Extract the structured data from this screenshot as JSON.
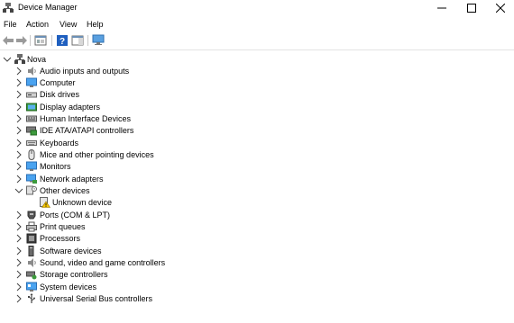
{
  "window": {
    "title": "Device Manager"
  },
  "menu": [
    "File",
    "Action",
    "View",
    "Help"
  ],
  "tree": {
    "root": "Nova",
    "categories": [
      {
        "label": "Audio inputs and outputs",
        "icon": "speaker-icon"
      },
      {
        "label": "Computer",
        "icon": "monitor-icon"
      },
      {
        "label": "Disk drives",
        "icon": "disk-drive-icon"
      },
      {
        "label": "Display adapters",
        "icon": "display-adapter-icon"
      },
      {
        "label": "Human Interface Devices",
        "icon": "hid-icon"
      },
      {
        "label": "IDE ATA/ATAPI controllers",
        "icon": "ide-controller-icon"
      },
      {
        "label": "Keyboards",
        "icon": "keyboard-icon"
      },
      {
        "label": "Mice and other pointing devices",
        "icon": "mouse-icon"
      },
      {
        "label": "Monitors",
        "icon": "monitor-icon"
      },
      {
        "label": "Network adapters",
        "icon": "network-adapter-icon"
      },
      {
        "label": "Other devices",
        "icon": "other-devices-icon",
        "expanded": true,
        "children": [
          {
            "label": "Unknown device",
            "icon": "unknown-device-warning-icon"
          }
        ]
      },
      {
        "label": "Ports (COM & LPT)",
        "icon": "port-icon"
      },
      {
        "label": "Print queues",
        "icon": "printer-icon"
      },
      {
        "label": "Processors",
        "icon": "processor-icon"
      },
      {
        "label": "Software devices",
        "icon": "software-device-icon"
      },
      {
        "label": "Sound, video and game controllers",
        "icon": "speaker-icon"
      },
      {
        "label": "Storage controllers",
        "icon": "storage-controller-icon"
      },
      {
        "label": "System devices",
        "icon": "system-devices-icon"
      },
      {
        "label": "Universal Serial Bus controllers",
        "icon": "usb-icon"
      }
    ]
  }
}
